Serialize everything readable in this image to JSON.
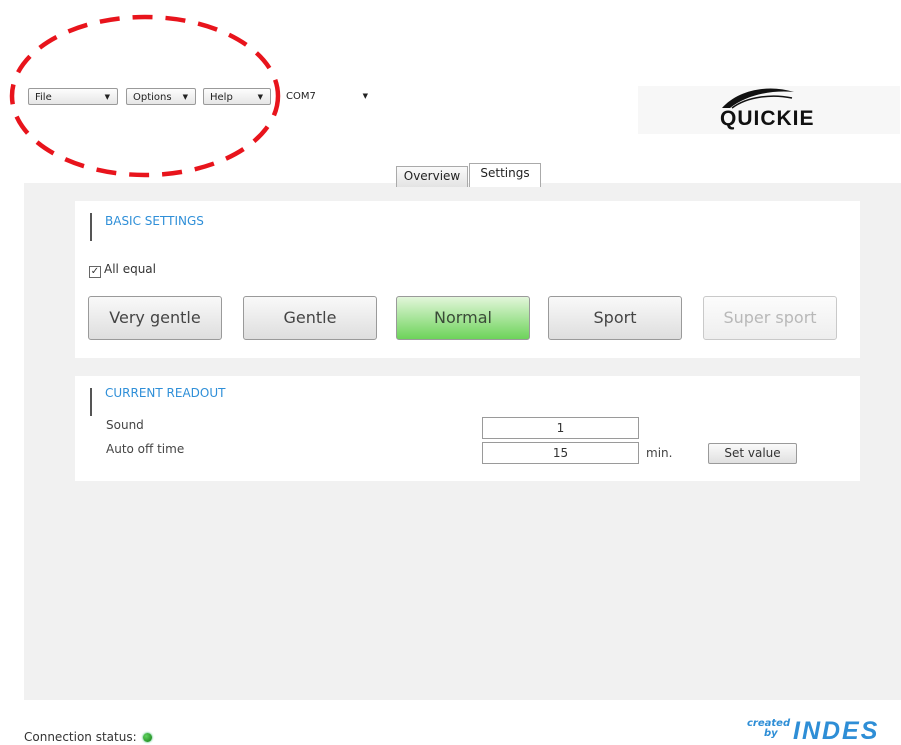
{
  "menubar": {
    "file": "File",
    "options": "Options",
    "help": "Help",
    "port": "COM7"
  },
  "logo": {
    "text": "QUICKIE"
  },
  "tabs": {
    "overview": "Overview",
    "settings": "Settings",
    "active": "Settings"
  },
  "basic": {
    "heading": "BASIC SETTINGS",
    "all_equal_label": "All equal",
    "all_equal_checked": true,
    "modes": [
      {
        "label": "Very gentle",
        "state": "normal"
      },
      {
        "label": "Gentle",
        "state": "normal"
      },
      {
        "label": "Normal",
        "state": "selected"
      },
      {
        "label": "Sport",
        "state": "normal"
      },
      {
        "label": "Super sport",
        "state": "disabled"
      }
    ]
  },
  "readout": {
    "heading": "CURRENT READOUT",
    "sound_label": "Sound",
    "sound_value": "1",
    "auto_off_label": "Auto off time",
    "auto_off_value": "15",
    "unit": "min.",
    "set_value_button": "Set value"
  },
  "status": {
    "connection_label": "Connection status:",
    "connected_color": "#22aa22"
  },
  "brand": {
    "created": "created",
    "by": "by",
    "name": "INDES"
  },
  "colors": {
    "accent": "#2f8fd8",
    "selected_mode": "#6dd35a",
    "annotation": "#e8141c"
  }
}
